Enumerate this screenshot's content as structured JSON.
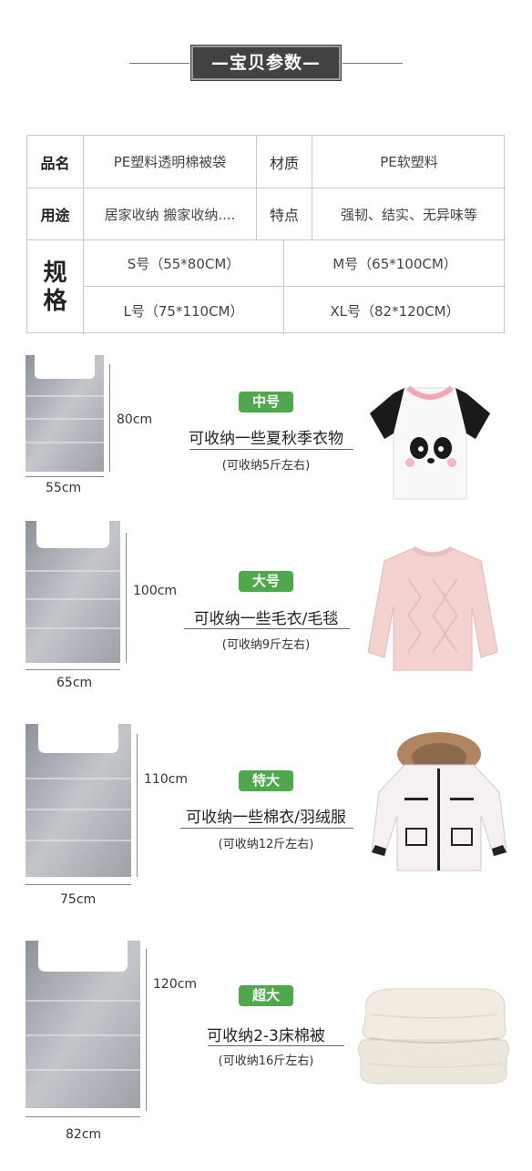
{
  "header": {
    "title": "—宝贝参数—"
  },
  "spec": {
    "name_label": "品名",
    "name_value": "PE塑料透明棉被袋",
    "material_label": "材质",
    "material_value": "PE软塑料",
    "use_label": "用途",
    "use_value": "居家收纳 搬家收纳....",
    "feature_label": "特点",
    "feature_value": "强韧、结实、无异味等",
    "size_label_1": "规",
    "size_label_2": "格",
    "sizes": [
      "S号（55*80CM）",
      "M号（65*100CM）",
      "L号（75*110CM）",
      "XL号（82*120CM）"
    ]
  },
  "items": [
    {
      "height": "80cm",
      "width": "55cm",
      "badge": "中号",
      "desc": "可收纳一些夏秋季衣物",
      "sub": "(可收纳5斤左右)",
      "item_icon": "panda-tshirt-icon"
    },
    {
      "height": "100cm",
      "width": "65cm",
      "badge": "大号",
      "desc": "可收纳一些毛衣/毛毯",
      "sub": "(可收纳9斤左右)",
      "item_icon": "pink-sweater-icon"
    },
    {
      "height": "110cm",
      "width": "75cm",
      "badge": "特大",
      "desc": "可收纳一些棉衣/羽绒服",
      "sub": "(可收纳12斤左右)",
      "item_icon": "down-jacket-icon"
    },
    {
      "height": "120cm",
      "width": "82cm",
      "badge": "超大",
      "desc": "可收纳2-3床棉被",
      "sub": "(可收纳16斤左右)",
      "item_icon": "folded-quilt-icon"
    }
  ],
  "colors": {
    "badge_green": "#4fa84b",
    "header_bg": "#424242"
  }
}
